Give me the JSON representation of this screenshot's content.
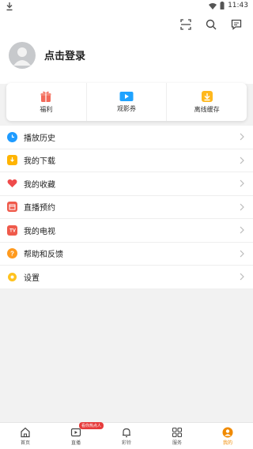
{
  "status": {
    "time": "11:43"
  },
  "header": {
    "login_label": "点击登录"
  },
  "quick": [
    {
      "label": "福利",
      "icon": "gift-icon"
    },
    {
      "label": "观影券",
      "icon": "ticket-icon"
    },
    {
      "label": "离线缓存",
      "icon": "download-cache-icon"
    }
  ],
  "menu": [
    {
      "label": "播放历史",
      "icon": "clock-icon",
      "color": "#1e9bff"
    },
    {
      "label": "我的下载",
      "icon": "download-icon",
      "color": "#ffb400"
    },
    {
      "label": "我的收藏",
      "icon": "heart-icon",
      "color": "#ef4b4b"
    },
    {
      "label": "直播预约",
      "icon": "calendar-icon",
      "color": "#ef5a4b"
    },
    {
      "label": "我的电视",
      "icon": "tv-icon",
      "color": "#ef5a4b"
    },
    {
      "label": "帮助和反馈",
      "icon": "help-icon",
      "color": "#ff9a1e"
    },
    {
      "label": "设置",
      "icon": "settings-icon",
      "color": "#ffc21e"
    }
  ],
  "tabs": [
    {
      "label": "首页",
      "icon": "home-icon"
    },
    {
      "label": "直播",
      "icon": "live-icon",
      "badge": "看你热点人"
    },
    {
      "label": "彩铃",
      "icon": "bell-icon"
    },
    {
      "label": "服务",
      "icon": "grid-icon"
    },
    {
      "label": "我的",
      "icon": "profile-icon",
      "active": true
    }
  ],
  "colors": {
    "accent": "#f08a00"
  }
}
